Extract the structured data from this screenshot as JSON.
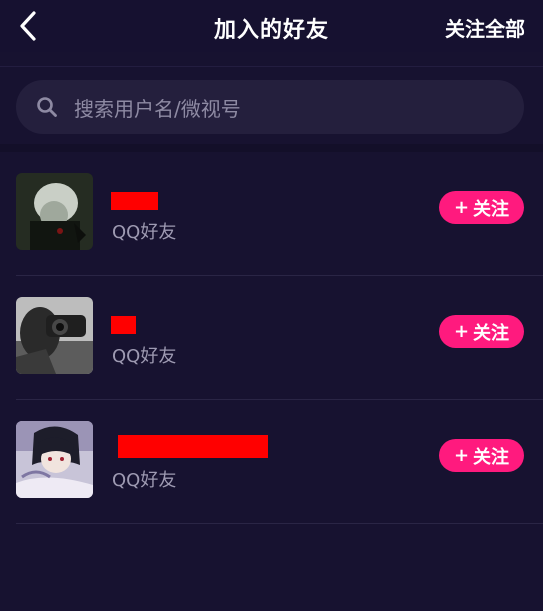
{
  "header": {
    "back_icon": "chevron-left-icon",
    "title": "加入的好友",
    "follow_all_label": "关注全部"
  },
  "search": {
    "icon": "search-icon",
    "placeholder": "搜索用户名/微视号"
  },
  "friends": [
    {
      "source": "QQ好友",
      "follow_label": "关注",
      "follow_icon": "plus-icon"
    },
    {
      "source": "QQ好友",
      "follow_label": "关注",
      "follow_icon": "plus-icon"
    },
    {
      "source": "QQ好友",
      "follow_label": "关注",
      "follow_icon": "plus-icon"
    }
  ],
  "colors": {
    "background": "#171230",
    "search_bg": "#241f3d",
    "follow_button": "#ff1a7e",
    "secondary_text": "#9e9ab2",
    "redaction": "#ff0000"
  }
}
